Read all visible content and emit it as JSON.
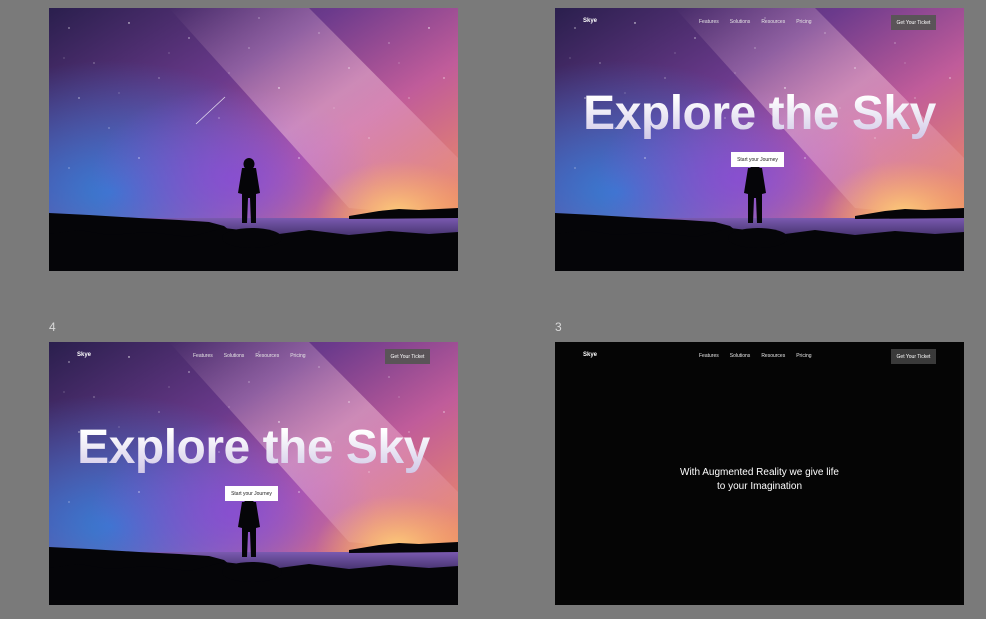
{
  "labels": {
    "frame_a": "4",
    "frame_b": "3"
  },
  "nav": {
    "logo": "Skye",
    "links": [
      "Features",
      "Solutions",
      "Resources",
      "Pricing"
    ],
    "cta": "Get Your Ticket"
  },
  "hero": {
    "title": "Explore the Sky",
    "button": "Start your Journey"
  },
  "dark_frame": {
    "line1": "With Augmented Reality we give life",
    "line2": "to your Imagination"
  },
  "colors": {
    "background": "#7a7a7a",
    "dark": "#050505",
    "cta_bg": "#5a5458"
  }
}
